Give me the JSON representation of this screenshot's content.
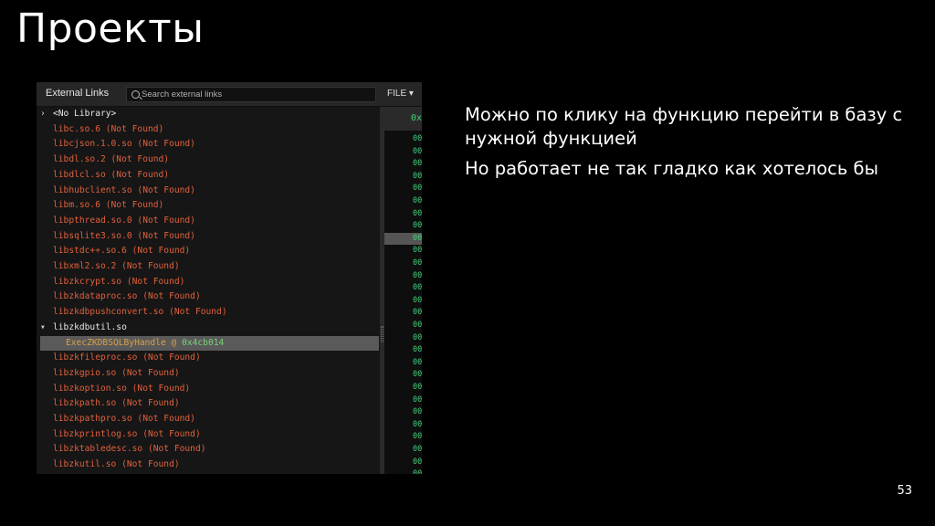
{
  "slide": {
    "title": "Проекты",
    "bullets": [
      "Можно по клику на функцию перейти в базу с нужной функцией",
      "Но работает не так гладко как хотелось бы"
    ],
    "page_number": "53"
  },
  "panel": {
    "title": "External Links",
    "search_placeholder": "Search external links",
    "file_menu": "FILE ▾",
    "hex_header": "0x",
    "tree": [
      {
        "label": "<No Library>",
        "arrow": "›",
        "kind": "white"
      },
      {
        "label": "libc.so.6 (Not Found)"
      },
      {
        "label": "libcjson.1.0.so (Not Found)"
      },
      {
        "label": "libdl.so.2 (Not Found)"
      },
      {
        "label": "libdlcl.so (Not Found)"
      },
      {
        "label": "libhubclient.so (Not Found)"
      },
      {
        "label": "libm.so.6 (Not Found)"
      },
      {
        "label": "libpthread.so.0 (Not Found)"
      },
      {
        "label": "libsqlite3.so.0 (Not Found)"
      },
      {
        "label": "libstdc++.so.6 (Not Found)"
      },
      {
        "label": "libxml2.so.2 (Not Found)"
      },
      {
        "label": "libzkcrypt.so (Not Found)"
      },
      {
        "label": "libzkdataproc.so (Not Found)"
      },
      {
        "label": "libzkdbpushconvert.so (Not Found)"
      },
      {
        "label": "libzkdbutil.so",
        "arrow": "▾",
        "kind": "white"
      },
      {
        "label": "ExecZKDBSQLByHandle @ ",
        "addr": "0x4cb014",
        "kind": "selected"
      },
      {
        "label": "libzkfileproc.so (Not Found)"
      },
      {
        "label": "libzkgpio.so (Not Found)"
      },
      {
        "label": "libzkoption.so (Not Found)"
      },
      {
        "label": "libzkpath.so (Not Found)"
      },
      {
        "label": "libzkpathpro.so (Not Found)"
      },
      {
        "label": "libzkprintlog.so (Not Found)"
      },
      {
        "label": "libzktabledesc.so (Not Found)"
      },
      {
        "label": "libzkutil.so (Not Found)"
      }
    ],
    "hex_cells": [
      "00",
      "00",
      "00",
      "00",
      "00",
      "00",
      "00",
      "00",
      "00",
      "00",
      "00",
      "00",
      "00",
      "00",
      "00",
      "00",
      "00",
      "00",
      "00",
      "00",
      "00",
      "00",
      "00",
      "00",
      "00",
      "00",
      "00",
      "00",
      "00"
    ],
    "hex_selected_index": 8,
    "colors": {
      "missing_lib": "#e0603c",
      "address": "#7cd17c",
      "hex": "#3fd37a",
      "selection": "#5a5a5a"
    }
  }
}
